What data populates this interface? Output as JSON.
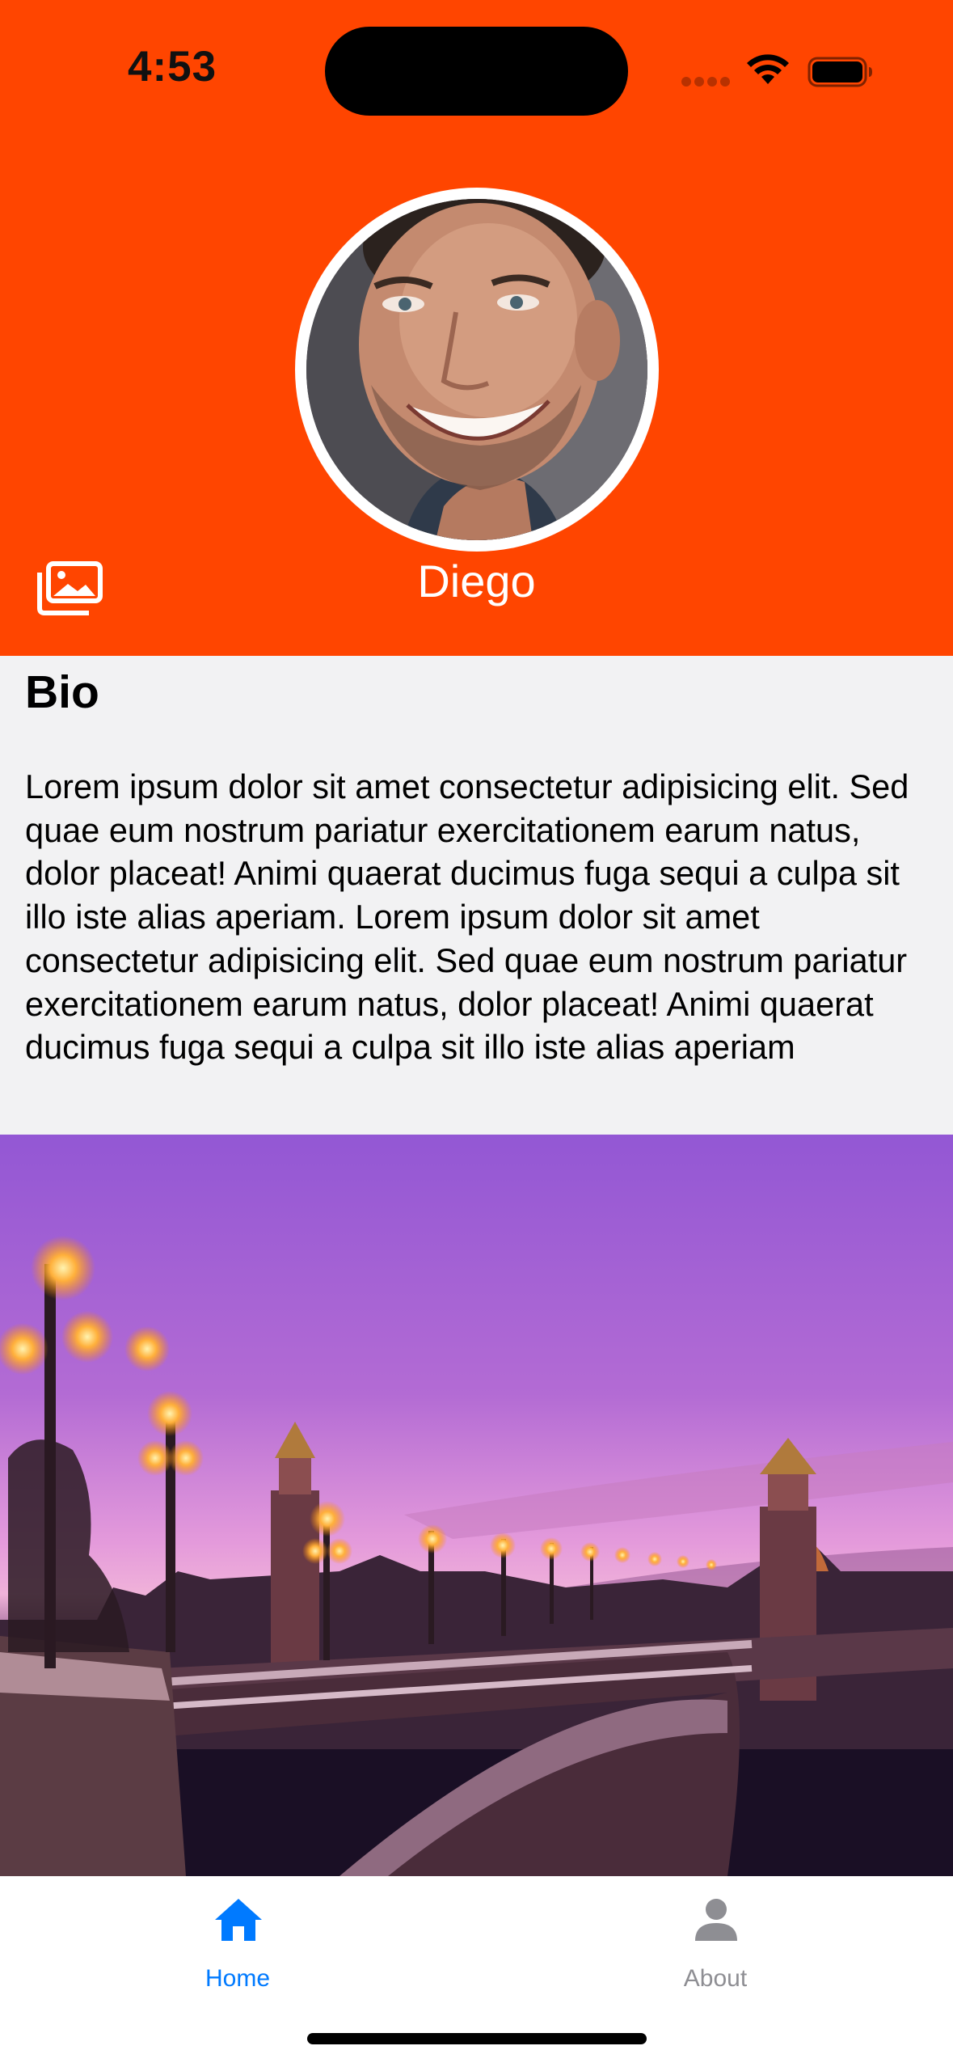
{
  "status_bar": {
    "time": "4:53"
  },
  "profile": {
    "name": "Diego",
    "avatar_icon": "person-photo",
    "gallery_icon": "photo-library-icon"
  },
  "bio": {
    "title": "Bio",
    "text": "Lorem ipsum dolor sit amet consectetur adipisicing elit. Sed quae eum nostrum pariatur exercitationem earum natus, dolor placeat! Animi quaerat ducimus fuga sequi a culpa sit illo iste alias aperiam. Lorem ipsum dolor sit amet consectetur adipisicing elit. Sed quae eum nostrum pariatur exercitationem earum natus, dolor placeat! Animi quaerat ducimus fuga sequi a culpa sit illo iste alias aperiam"
  },
  "photo": {
    "icon": "bridge-sunset-photo"
  },
  "tabs": [
    {
      "label": "Home",
      "icon": "house-icon",
      "active": true
    },
    {
      "label": "About",
      "icon": "person-icon",
      "active": false
    }
  ],
  "colors": {
    "header_bg": "#FF4500",
    "bio_bg": "#F2F2F3",
    "tab_active": "#007AFF",
    "tab_inactive": "#8E8E93"
  }
}
